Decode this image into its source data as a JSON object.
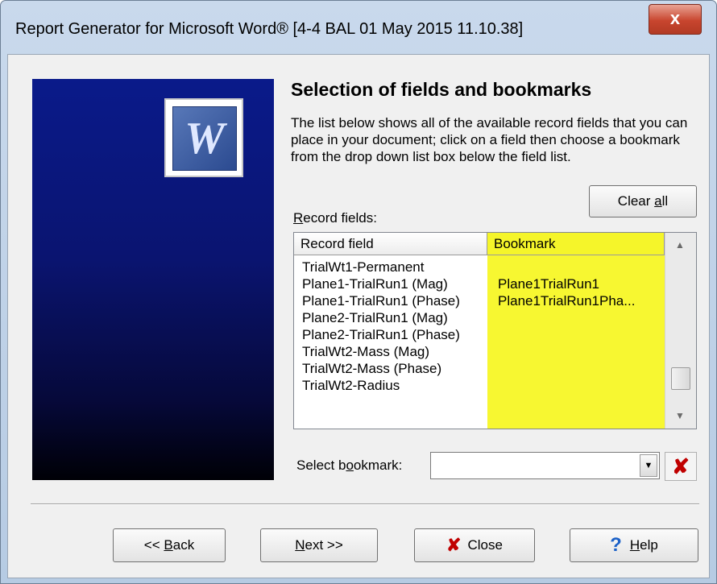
{
  "window": {
    "title": "Report Generator for Microsoft Word® [4-4 BAL 01 May 2015 11.10.38]",
    "close_glyph": "x"
  },
  "banner": {
    "logo_letter": "W",
    "logo_icon": "word-icon"
  },
  "content": {
    "heading": "Selection of fields and bookmarks",
    "description": "The list below shows all of the available record fields that you can place in your document; click on a field then choose a bookmark from the drop down list box below the field list.",
    "clear_all_pre": "Clear ",
    "clear_all_u": "a",
    "clear_all_post": "ll",
    "record_fields_u": "R",
    "record_fields_post": "ecord fields:"
  },
  "grid": {
    "headers": [
      "Record field",
      "Bookmark"
    ],
    "rows": [
      {
        "field": "TrialWt1-Permanent",
        "bookmark": ""
      },
      {
        "field": "Plane1-TrialRun1 (Mag)",
        "bookmark": "Plane1TrialRun1"
      },
      {
        "field": "Plane1-TrialRun1 (Phase)",
        "bookmark": "Plane1TrialRun1Pha..."
      },
      {
        "field": "Plane2-TrialRun1 (Mag)",
        "bookmark": ""
      },
      {
        "field": "Plane2-TrialRun1 (Phase)",
        "bookmark": ""
      },
      {
        "field": "TrialWt2-Mass (Mag)",
        "bookmark": ""
      },
      {
        "field": "TrialWt2-Mass (Phase)",
        "bookmark": ""
      },
      {
        "field": "TrialWt2-Radius",
        "bookmark": ""
      }
    ],
    "bookmark_highlight_color": "#f7f731"
  },
  "select_bookmark": {
    "label_pre": "Select b",
    "label_u": "o",
    "label_post": "okmark:",
    "value": "",
    "dropdown_icon": "chevron-down-icon",
    "delete_icon": "red-x-icon"
  },
  "buttons": {
    "back_pre": "<<  ",
    "back_u": "B",
    "back_post": "ack",
    "next_u": "N",
    "next_post": "ext  >>",
    "close_label": "Close",
    "help_u": "H",
    "help_post": "elp"
  }
}
